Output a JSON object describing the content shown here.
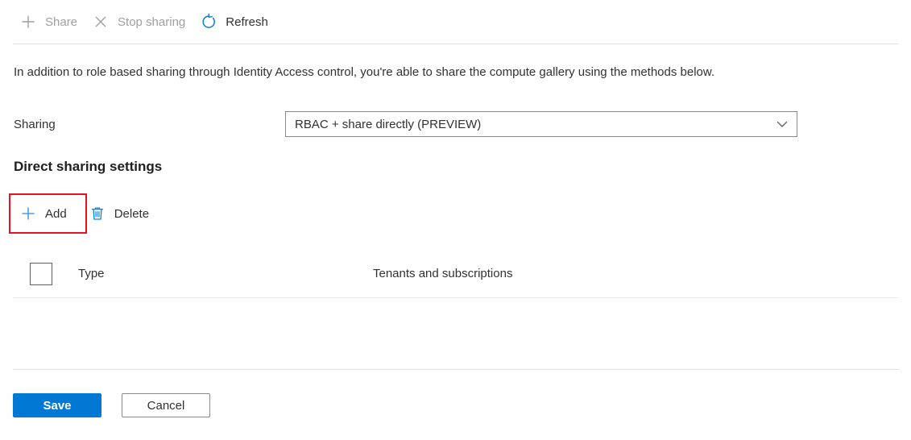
{
  "colors": {
    "accent": "#0078d4",
    "disabled_text": "#a19f9d",
    "text": "#323130",
    "highlight_outline": "#e81123",
    "border": "#8a8886",
    "divider": "#e1dfdd"
  },
  "commandbar": {
    "items": [
      {
        "label": "Share",
        "icon": "plus-icon",
        "enabled": false
      },
      {
        "label": "Stop sharing",
        "icon": "close-x-icon",
        "enabled": false
      },
      {
        "label": "Refresh",
        "icon": "refresh-icon",
        "enabled": true
      }
    ]
  },
  "description": "In addition to role based sharing through Identity Access control, you're able to share the compute gallery using the methods below.",
  "sharing": {
    "label": "Sharing",
    "selected": "RBAC + share directly (PREVIEW)",
    "chevron_icon": "chevron-down-icon"
  },
  "direct_sharing": {
    "title": "Direct sharing settings",
    "toolbar": [
      {
        "label": "Add",
        "icon": "plus-icon",
        "highlighted": true
      },
      {
        "label": "Delete",
        "icon": "trash-icon",
        "highlighted": false
      }
    ],
    "table": {
      "select_all_checked": false,
      "columns": [
        "Type",
        "Tenants and subscriptions"
      ],
      "rows": []
    }
  },
  "footer": {
    "save_label": "Save",
    "cancel_label": "Cancel"
  }
}
